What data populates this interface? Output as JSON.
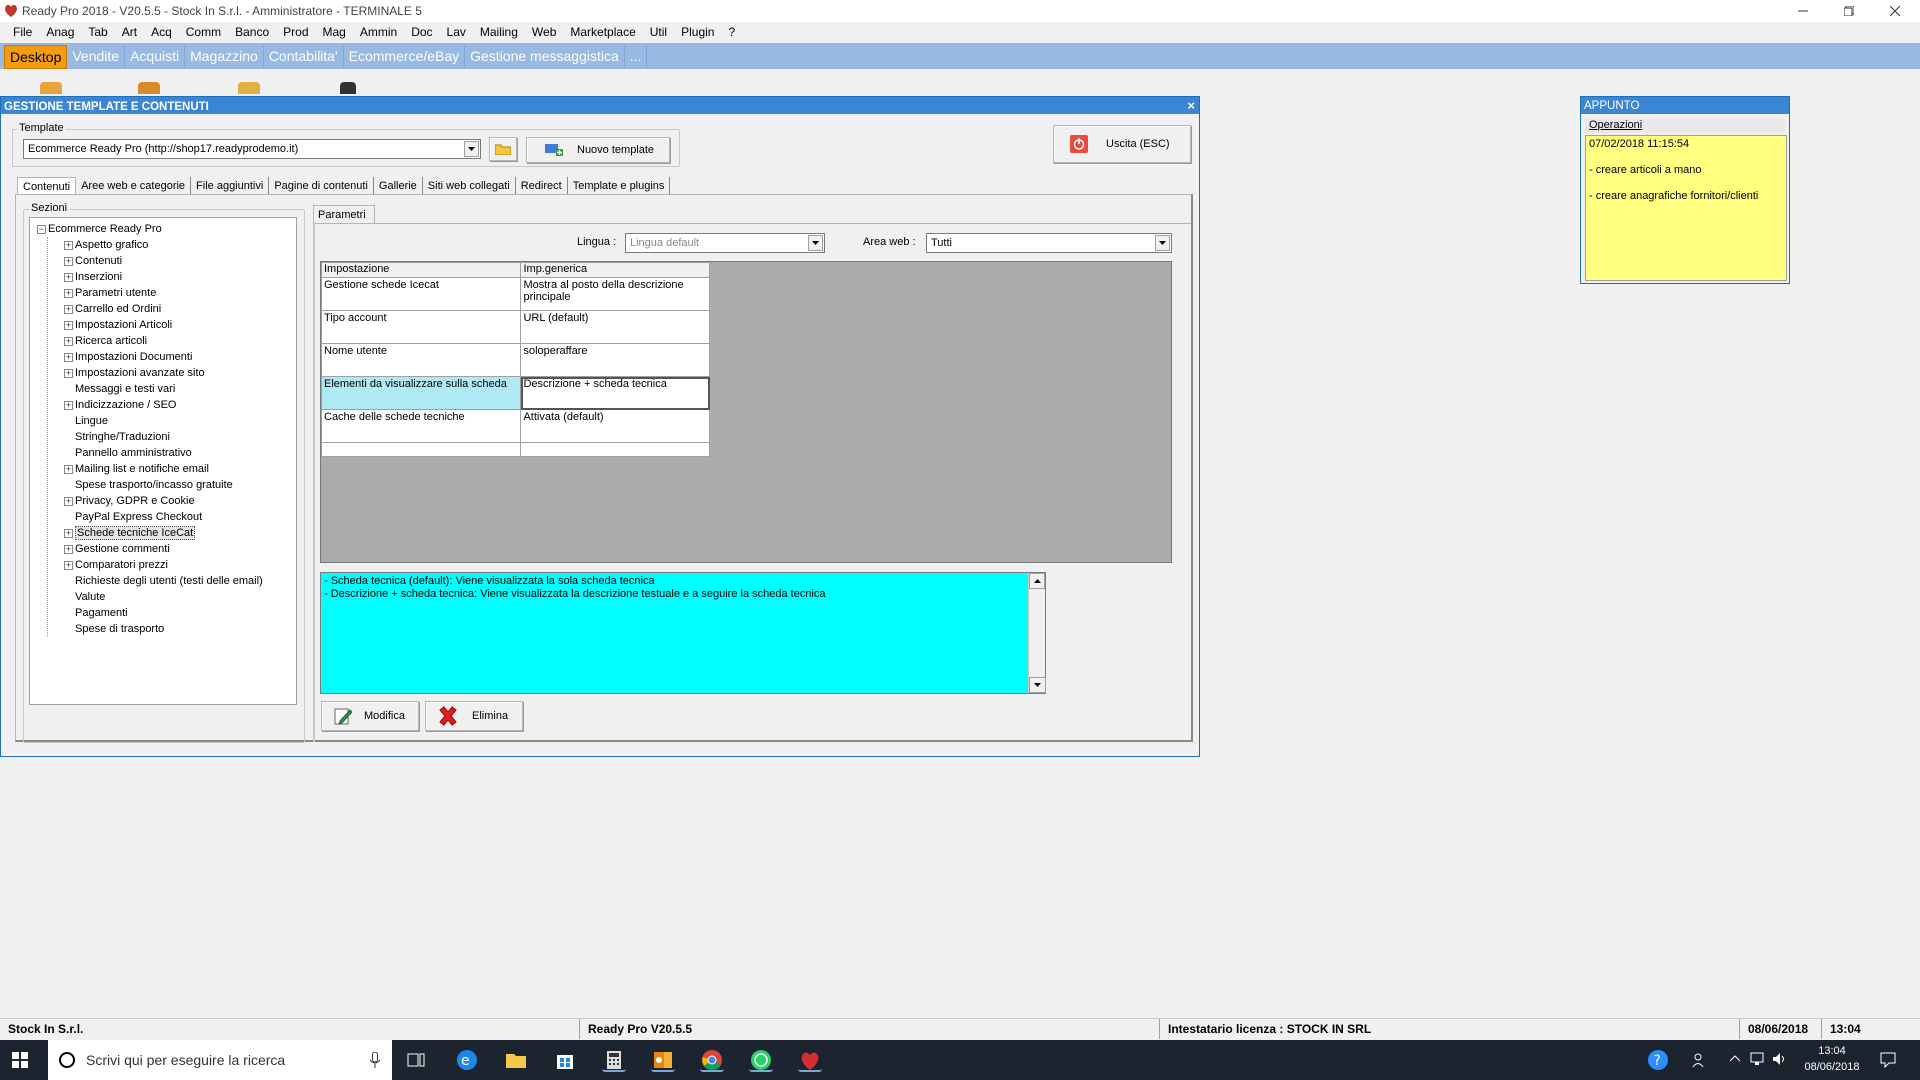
{
  "app": {
    "title": "Ready Pro 2018 - V20.5.5 - Stock In S.r.l. - Amministratore - TERMINALE 5"
  },
  "menu": [
    "File",
    "Anag",
    "Tab",
    "Art",
    "Acq",
    "Comm",
    "Banco",
    "Prod",
    "Mag",
    "Ammin",
    "Doc",
    "Lav",
    "Mailing",
    "Web",
    "Marketplace",
    "Util",
    "Plugin",
    "?"
  ],
  "module_tabs": [
    {
      "label": "Desktop",
      "active": true
    },
    {
      "label": "Vendite"
    },
    {
      "label": "Acquisti"
    },
    {
      "label": "Magazzino"
    },
    {
      "label": "Contabilita'"
    },
    {
      "label": "Ecommerce/eBay"
    },
    {
      "label": "Gestione messaggistica"
    },
    {
      "label": "..."
    }
  ],
  "window": {
    "title": "GESTIONE TEMPLATE E CONTENUTI",
    "close": "×",
    "template_label": "Template",
    "template_value": "Ecommerce Ready Pro (http://shop17.readyprodemo.it)",
    "new_template_label": "Nuovo template",
    "exit_label": "Uscita (ESC)",
    "tabs": [
      "Contenuti",
      "Aree web e categorie",
      "File aggiuntivi",
      "Pagine di contenuti",
      "Gallerie",
      "Siti web collegati",
      "Redirect",
      "Template e plugins"
    ],
    "sections_label": "Sezioni",
    "tree_root": "Ecommerce Ready Pro",
    "tree": [
      {
        "label": "Aspetto grafico",
        "exp": true
      },
      {
        "label": "Contenuti",
        "exp": true
      },
      {
        "label": "Inserzioni",
        "exp": true
      },
      {
        "label": "Parametri utente",
        "exp": true
      },
      {
        "label": "Carrello ed Ordini",
        "exp": true
      },
      {
        "label": "Impostazioni Articoli",
        "exp": true
      },
      {
        "label": "Ricerca articoli",
        "exp": true
      },
      {
        "label": "Impostazioni Documenti",
        "exp": true
      },
      {
        "label": "Impostazioni avanzate sito",
        "exp": true
      },
      {
        "label": "Messaggi e testi vari",
        "exp": false
      },
      {
        "label": "Indicizzazione / SEO",
        "exp": true
      },
      {
        "label": "Lingue",
        "exp": false
      },
      {
        "label": "Stringhe/Traduzioni",
        "exp": false
      },
      {
        "label": "Pannello amministrativo",
        "exp": false
      },
      {
        "label": "Mailing list e notifiche email",
        "exp": true
      },
      {
        "label": "Spese trasporto/incasso gratuite",
        "exp": false
      },
      {
        "label": "Privacy, GDPR e Cookie",
        "exp": true
      },
      {
        "label": "PayPal Express Checkout",
        "exp": false
      },
      {
        "label": "Schede tecniche IceCat",
        "exp": true,
        "selected": true
      },
      {
        "label": "Gestione commenti",
        "exp": true
      },
      {
        "label": "Comparatori prezzi",
        "exp": true
      },
      {
        "label": "Richieste degli utenti (testi delle email)",
        "exp": false
      },
      {
        "label": "Valute",
        "exp": false
      },
      {
        "label": "Pagamenti",
        "exp": false
      },
      {
        "label": "Spese di trasporto",
        "exp": false
      }
    ],
    "params_tab": "Parametri",
    "lingua_label": "Lingua :",
    "lingua_value": "Lingua default",
    "area_label": "Area web :",
    "area_value": "Tutti",
    "grid_headers": [
      "Impostazione",
      "Imp.generica"
    ],
    "grid_rows": [
      {
        "setting": "Gestione schede Icecat",
        "value": "Mostra al posto della descrizione principale"
      },
      {
        "setting": "Tipo account",
        "value": "URL (default)"
      },
      {
        "setting": "Nome utente",
        "value": "soloperaffare"
      },
      {
        "setting": "Elementi da visualizzare sulla scheda",
        "value": "Descrizione + scheda tecnica",
        "highlight": true
      },
      {
        "setting": "Cache delle schede tecniche",
        "value": "Attivata (default)"
      }
    ],
    "description": [
      "- Scheda tecnica (default): Viene visualizzata la sola scheda tecnica",
      "- Descrizione + scheda tecnica: Viene visualizzata la descrizione testuale e a seguire la scheda tecnica"
    ],
    "modify_label": "Modifica",
    "delete_label": "Elimina"
  },
  "appunto": {
    "title": "APPUNTO",
    "menu": "Operazioni",
    "lines": [
      "07/02/2018 11:15:54",
      "",
      "- creare articoli a mano",
      "",
      "- creare anagrafiche fornitori/clienti"
    ]
  },
  "status": {
    "company": "Stock In S.r.l.",
    "version": "Ready Pro V20.5.5",
    "license": "Intestatario licenza : STOCK IN SRL",
    "date": "08/06/2018",
    "time": "13:04"
  },
  "taskbar": {
    "search_placeholder": "Scrivi qui per eseguire la ricerca",
    "clock_time": "13:04",
    "clock_date": "08/06/2018"
  },
  "colors": {
    "module_bar": "#98b9e2",
    "active_tab": "#f39c12",
    "window_title": "#3b86d4",
    "description_bg": "#00ffff",
    "note_bg": "#ffff80",
    "taskbar": "#1c2430"
  }
}
